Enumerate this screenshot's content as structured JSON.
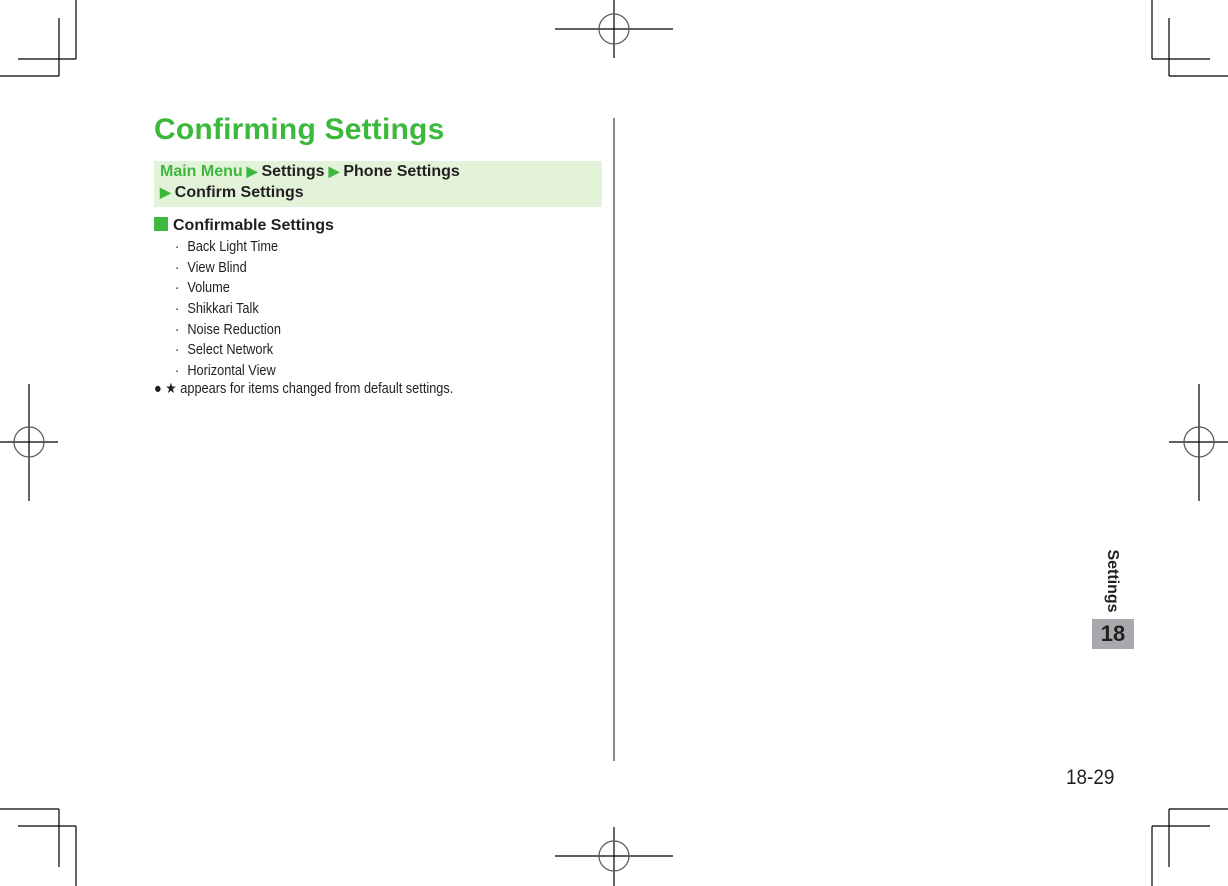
{
  "page": {
    "title": "Confirming Settings",
    "breadcrumb": {
      "items": [
        "Main Menu",
        "Settings",
        "Phone Settings",
        "Confirm Settings"
      ],
      "separator": "▶"
    },
    "section": {
      "heading": "Confirmable Settings",
      "bullet": "·",
      "items": [
        "Back Light Time",
        "View Blind",
        "Volume",
        "Shikkari Talk",
        "Noise Reduction",
        "Select Network",
        "Horizontal View"
      ]
    },
    "note": {
      "bullet": "●",
      "star": "★",
      "text": "appears for items changed from default settings."
    },
    "side_tab": {
      "label": "Settings",
      "chapter": "18"
    },
    "page_number": "18-29",
    "colors": {
      "accent_green": "#3cb83c",
      "breadcrumb_bg": "#e2f3da",
      "chapter_bg": "#a7a9ac"
    }
  }
}
